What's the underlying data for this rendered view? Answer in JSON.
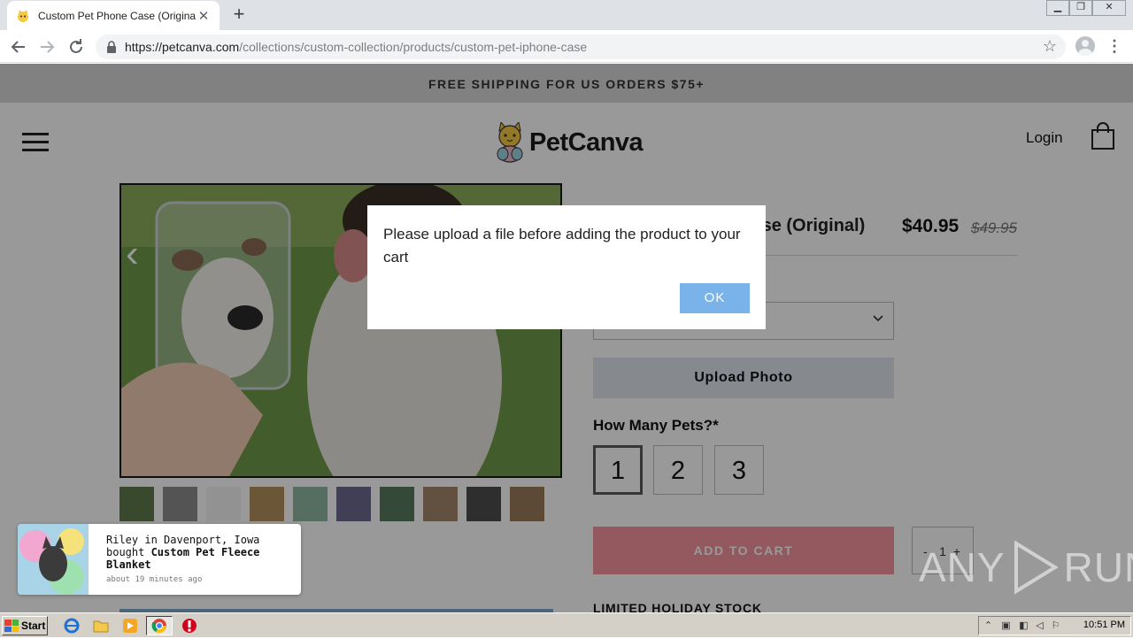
{
  "browser": {
    "tab_title": "Custom Pet Phone Case (Original) – P",
    "url_host": "https://petcanva.com",
    "url_path": "/collections/custom-collection/products/custom-pet-iphone-case"
  },
  "site": {
    "announcement": "FREE SHIPPING FOR US ORDERS $75+",
    "logo_text": "PetCanva",
    "login_label": "Login"
  },
  "product": {
    "title": "Custom Pet Phone Case (Original)",
    "visible_title": "Case (Original)",
    "price": "$40.95",
    "compare_price": "$49.95",
    "upload_label": "Upload Photo",
    "pets_label": "How Many Pets?*",
    "pet_options": [
      "1",
      "2",
      "3"
    ],
    "selected_pets": "1",
    "add_to_cart_label": "ADD TO CART",
    "quantity_minus": "-",
    "quantity": "1",
    "quantity_plus": "+",
    "stock_text": "LIMITED HOLIDAY STOCK"
  },
  "purchase_popup": {
    "line1": "Riley in Davenport, Iowa",
    "line2_prefix": "bought ",
    "product_name": "Custom Pet Fleece Blanket",
    "time": "about 19 minutes ago"
  },
  "dialog": {
    "message": "Please upload a file before adding the product to your cart",
    "ok_label": "OK"
  },
  "watermark": {
    "text_left": "ANY",
    "text_right": "RUN"
  },
  "taskbar": {
    "start_label": "Start",
    "clock": "10:51 PM"
  },
  "colors": {
    "add_to_cart": "#f6949e",
    "ok_button": "#7ab3ea",
    "upload_button": "#dfe6ef"
  }
}
